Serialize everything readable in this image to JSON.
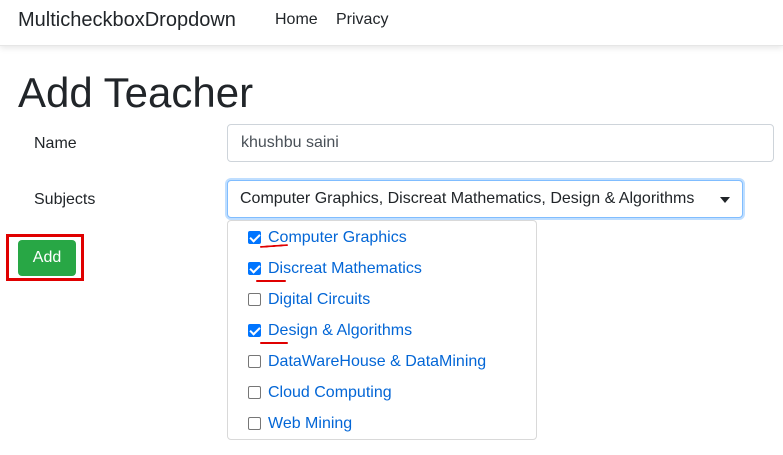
{
  "navbar": {
    "brand": "MulticheckboxDropdown",
    "links": [
      {
        "label": "Home"
      },
      {
        "label": "Privacy"
      }
    ]
  },
  "page": {
    "title": "Add Teacher"
  },
  "form": {
    "name_label": "Name",
    "name_value": "khushbu saini",
    "subjects_label": "Subjects",
    "subjects_summary": "Computer Graphics, Discreat Mathematics, Design & Algorithms",
    "submit_label": "Add"
  },
  "subjects": [
    {
      "label": "Computer Graphics",
      "checked": true
    },
    {
      "label": "Discreat Mathematics",
      "checked": true
    },
    {
      "label": "Digital Circuits",
      "checked": false
    },
    {
      "label": "Design & Algorithms",
      "checked": true
    },
    {
      "label": "DataWareHouse & DataMining",
      "checked": false
    },
    {
      "label": "Cloud Computing",
      "checked": false
    },
    {
      "label": "Web Mining",
      "checked": false
    }
  ],
  "colors": {
    "link": "#0366d6",
    "button": "#28a745",
    "annotation": "#e00000",
    "checkbox": "#0075ff"
  }
}
